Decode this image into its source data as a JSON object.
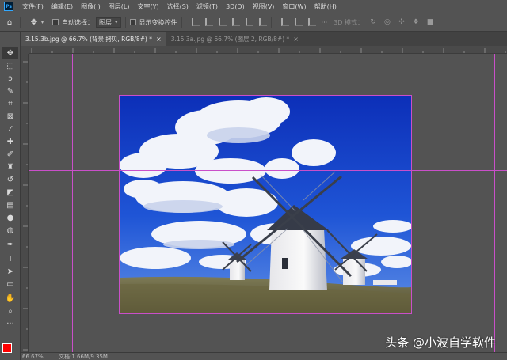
{
  "app": {
    "logo_text": "Ps"
  },
  "menu": [
    "文件(F)",
    "编辑(E)",
    "图像(I)",
    "图层(L)",
    "文字(Y)",
    "选择(S)",
    "滤镜(T)",
    "3D(D)",
    "视图(V)",
    "窗口(W)",
    "帮助(H)"
  ],
  "options": {
    "auto_select_label": "自动选择：",
    "auto_select_value": "图层",
    "show_transform_label": "显示变换控件",
    "mode_label": "3D 模式："
  },
  "tabs": [
    {
      "label": "3.15.3b.jpg @ 66.7% (背景 拷贝, RGB/8#) *",
      "active": true
    },
    {
      "label": "3.15.3a.jpg @ 66.7% (图层 2, RGB/8#) *",
      "active": false
    }
  ],
  "status": {
    "zoom": "66.67%",
    "doc": "文档:1.66M/9.35M"
  },
  "watermark": "头条 @小波自学软件",
  "colors": {
    "foreground": "#ff0000",
    "background": "#ffffff",
    "guide": "#c94fc9"
  },
  "tools": [
    "move-icon",
    "marquee-icon",
    "lasso-icon",
    "quick-select-icon",
    "crop-icon",
    "frame-icon",
    "eyedropper-icon",
    "healing-icon",
    "brush-icon",
    "stamp-icon",
    "history-brush-icon",
    "eraser-icon",
    "gradient-icon",
    "blur-icon",
    "dodge-icon",
    "pen-icon",
    "type-icon",
    "path-select-icon",
    "rectangle-icon",
    "hand-icon",
    "zoom-icon",
    "more-icon"
  ]
}
